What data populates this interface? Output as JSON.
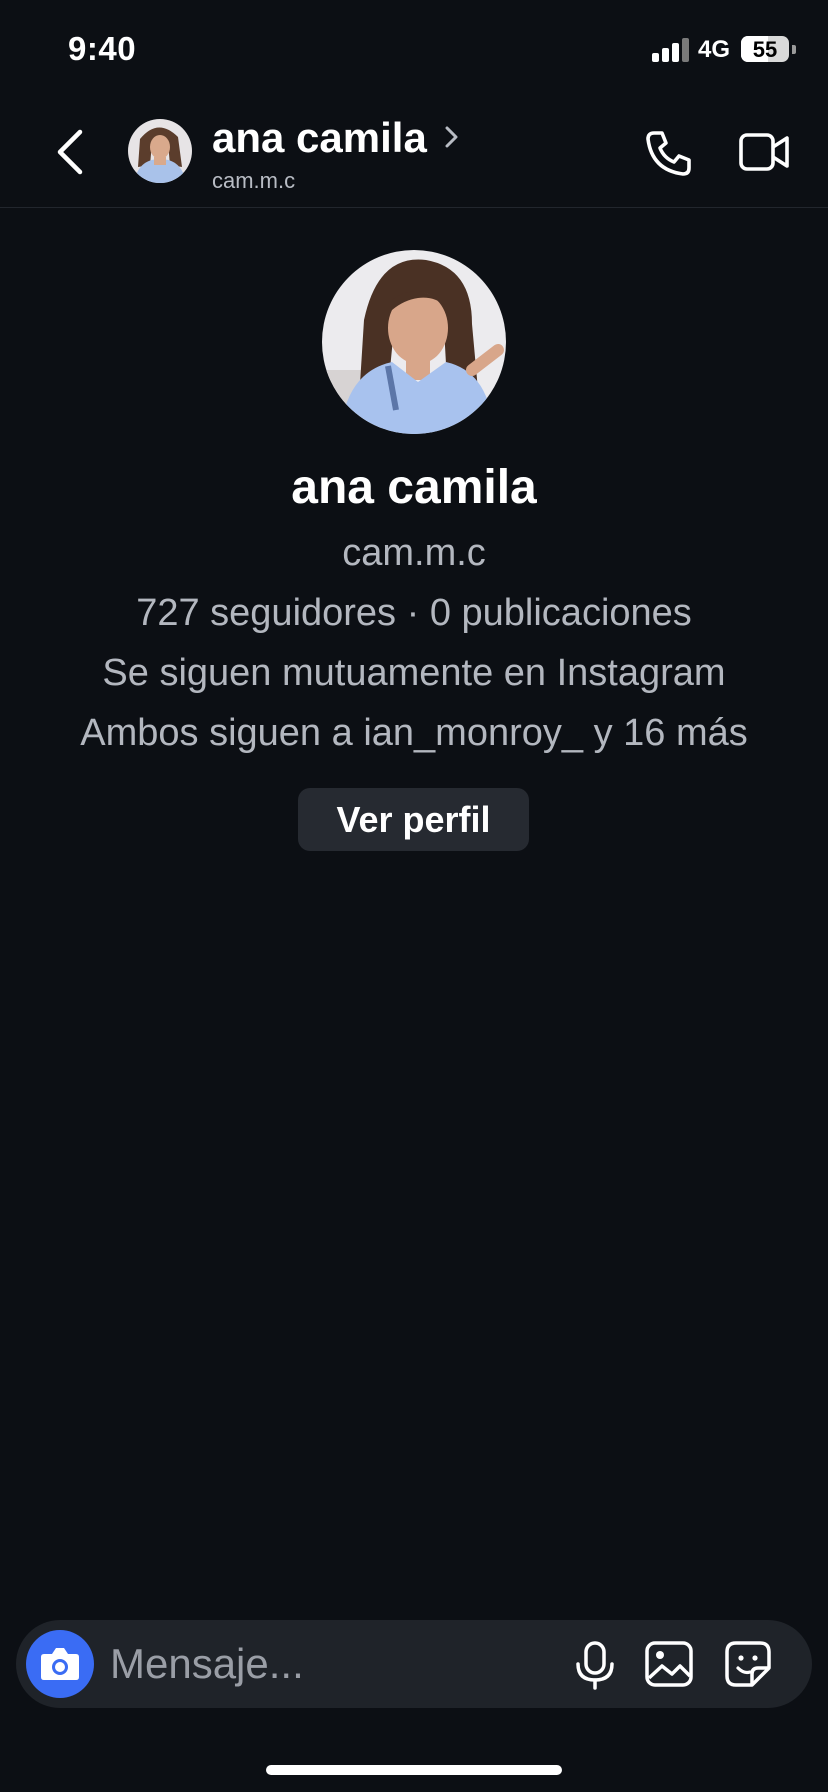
{
  "status_bar": {
    "time": "9:40",
    "network": "4G",
    "battery": "55"
  },
  "header": {
    "name": "ana camila",
    "username": "cam.m.c",
    "icons": [
      "back-arrow-icon",
      "chevron-right-icon",
      "phone-icon",
      "video-camera-icon"
    ]
  },
  "profile": {
    "name": "ana camila",
    "username": "cam.m.c",
    "stats": "727 seguidores · 0 publicaciones",
    "mutual": "Se siguen mutuamente en Instagram",
    "common": "Ambos siguen a ian_monroy_ y 16 más",
    "view_profile_label": "Ver perfil"
  },
  "composer": {
    "placeholder": "Mensaje...",
    "icons": [
      "camera-icon",
      "microphone-icon",
      "gallery-icon",
      "sticker-icon"
    ]
  },
  "colors": {
    "background": "#0c0f14",
    "accent": "#3a6cf4",
    "button_bg": "#262a31",
    "secondary_text": "#b3b7bf"
  }
}
